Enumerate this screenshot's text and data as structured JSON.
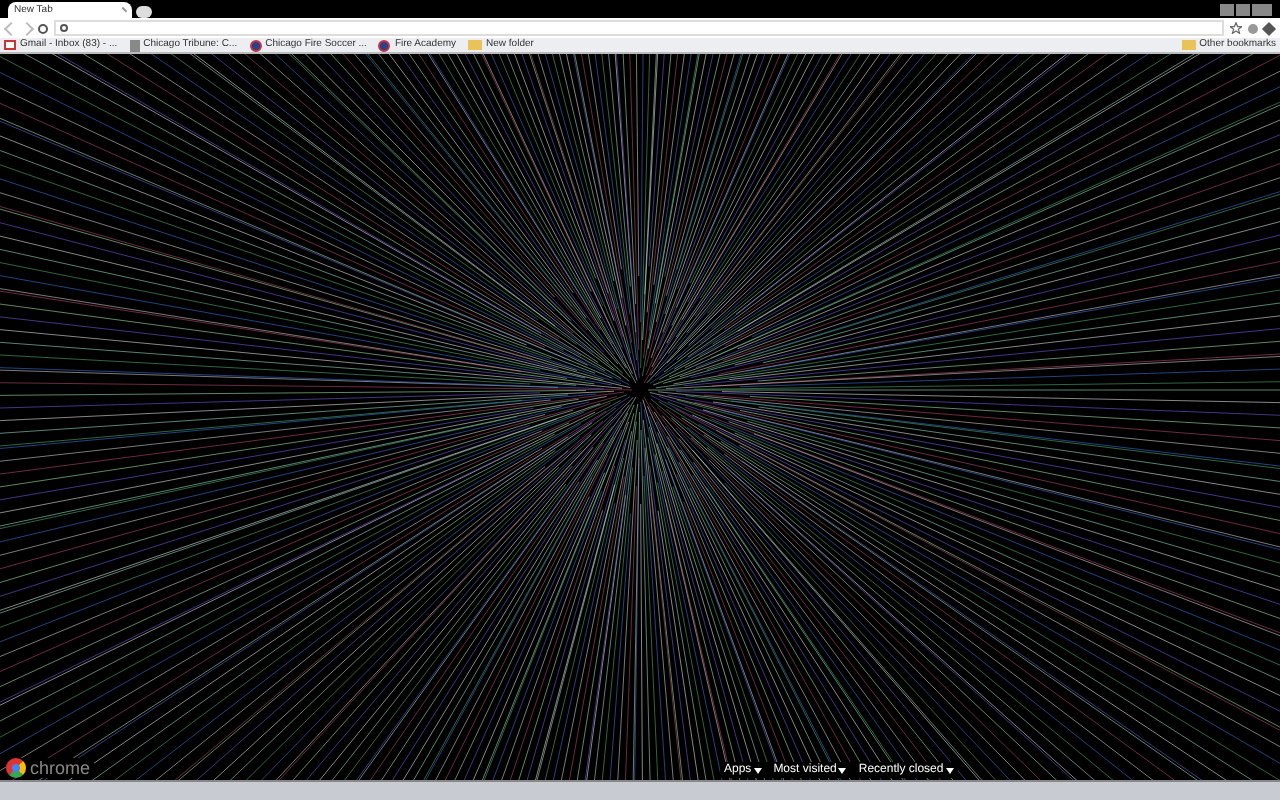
{
  "tabs": [
    {
      "label": "New Tab",
      "selected": true
    }
  ],
  "bookmarks": [
    {
      "label": "Gmail - Inbox (83) - ...",
      "kind": "mail"
    },
    {
      "label": "Chicago Tribune: C...",
      "kind": "page"
    },
    {
      "label": "Chicago Fire Soccer ...",
      "kind": "site"
    },
    {
      "label": "Fire Academy",
      "kind": "site"
    },
    {
      "label": "New folder",
      "kind": "folder"
    }
  ],
  "other_bookmarks": "Other bookmarks",
  "logo": "chrome",
  "footer_menus": [
    {
      "label": "Apps"
    },
    {
      "label": "Most visited"
    },
    {
      "label": "Recently closed"
    }
  ]
}
